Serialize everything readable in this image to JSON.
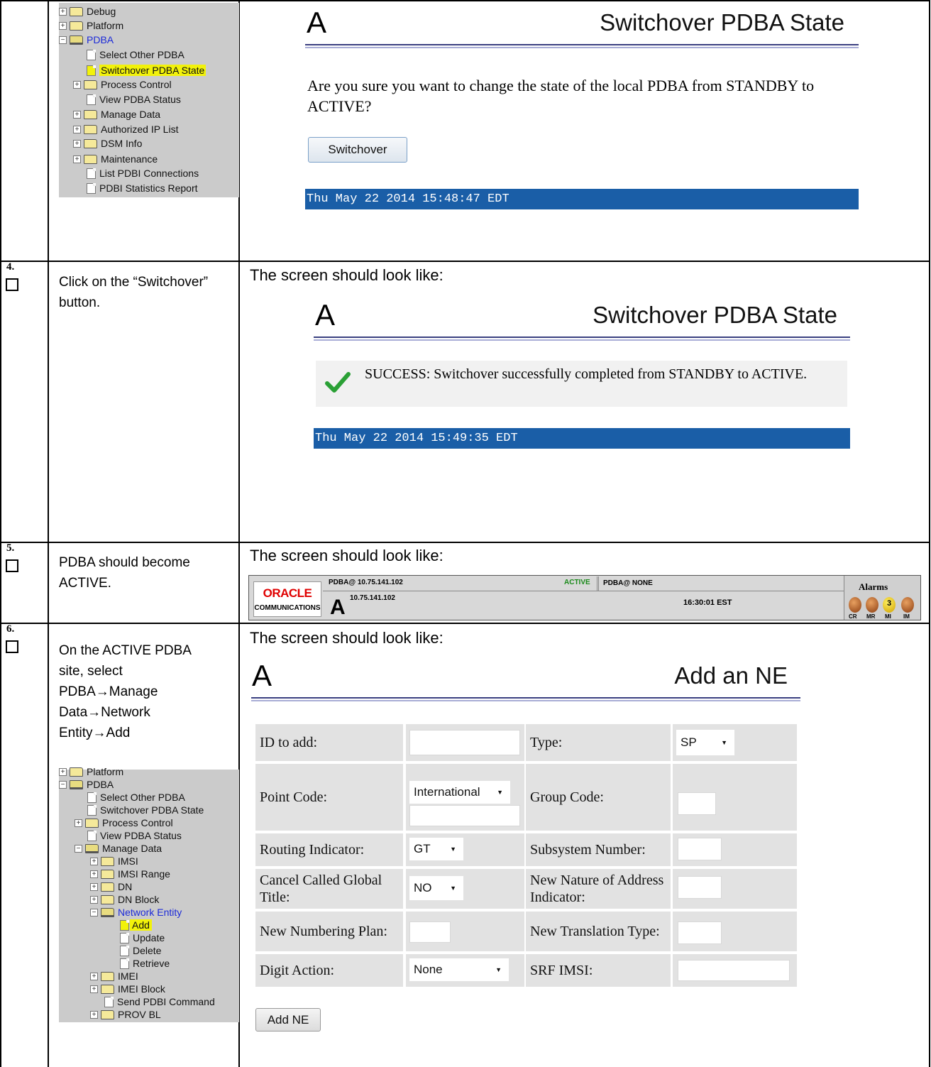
{
  "tree1": {
    "items": [
      "Debug",
      "Platform",
      "PDBA",
      "Select Other PDBA",
      "Switchover PDBA State",
      "Process Control",
      "View PDBA Status",
      "Manage Data",
      "Authorized IP List",
      "DSM Info",
      "Maintenance",
      "List PDBI Connections",
      "PDBI Statistics Report"
    ]
  },
  "panel1": {
    "logo": "A",
    "title": "Switchover PDBA State",
    "question": "Are you sure you want to change the state of the local PDBA from STANDBY to ACTIVE?",
    "button": "Switchover",
    "timestamp": "Thu May 22 2014 15:48:47 EDT"
  },
  "step4": {
    "num": "4.",
    "instruction": "Click on the “Switchover” button.",
    "expect": "The screen should look like:",
    "logo": "A",
    "title": "Switchover PDBA State",
    "message": "SUCCESS: Switchover successfully completed from STANDBY to ACTIVE.",
    "timestamp": "Thu May 22 2014 15:49:35 EDT"
  },
  "step5": {
    "num": "5.",
    "instruction": "PDBA should become ACTIVE.",
    "expect": "The screen should look like:",
    "banner": {
      "brand": "ORACLE",
      "brand_sub": "COMMUNICATIONS",
      "logo": "A",
      "host_top": "PDBA@ 10.75.141.102",
      "state": "ACTIVE",
      "mate": "PDBA@ NONE",
      "host_ip": "10.75.141.102",
      "time": "16:30:01 EST",
      "alarms_title": "Alarms",
      "alarm_count": "3",
      "alarm_labels": [
        "CR",
        "MR",
        "MI",
        "IM"
      ],
      "state_color": "#1a8a1a"
    }
  },
  "step6": {
    "num": "6.",
    "instruction": "On the ACTIVE PDBA site, select PDBA→Manage Data→Network Entity→Add",
    "expect": "The screen should look like:",
    "tree": [
      "Platform",
      "PDBA",
      "Select Other PDBA",
      "Switchover PDBA State",
      "Process Control",
      "View PDBA Status",
      "Manage Data",
      "IMSI",
      "IMSI Range",
      "DN",
      "DN Block",
      "Network Entity",
      "Add",
      "Update",
      "Delete",
      "Retrieve",
      "IMEI",
      "IMEI Block",
      "Send PDBI Command",
      "PROV BL"
    ],
    "form": {
      "logo": "A",
      "title": "Add an NE",
      "labels": {
        "id": "ID to add:",
        "type": "Type:",
        "point_code": "Point Code:",
        "group_code": "Group Code:",
        "routing": "Routing Indicator:",
        "ssn": "Subsystem Number:",
        "cancel_gt": "Cancel Called Global Title:",
        "new_nai": "New Nature of Address Indicator:",
        "new_np": "New Numbering Plan:",
        "new_tt": "New Translation Type:",
        "digit_action": "Digit Action:",
        "srf_imsi": "SRF IMSI:"
      },
      "values": {
        "type": "SP",
        "point_code_type": "International",
        "routing": "GT",
        "cancel_gt": "NO",
        "digit_action": "None"
      },
      "submit": "Add NE"
    }
  }
}
